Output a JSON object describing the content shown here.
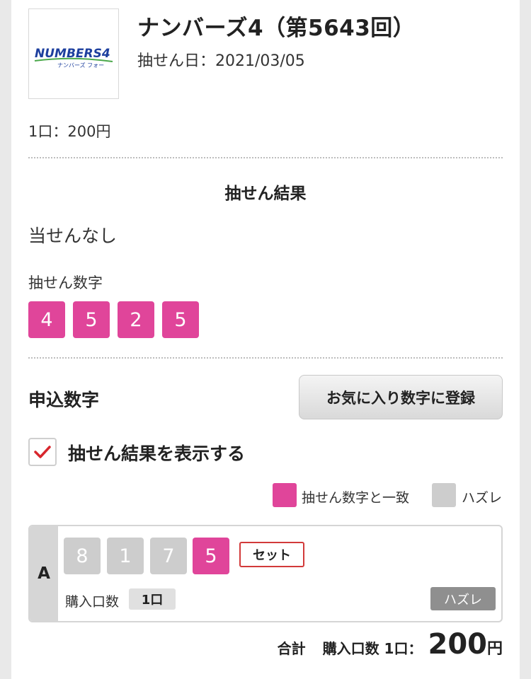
{
  "header": {
    "logo_text": "NUMBERS4",
    "logo_sub": "ナンバーズ フォー",
    "title": "ナンバーズ4（第5643回）",
    "draw_date": "抽せん日：2021/03/05",
    "unit_price": "1口：200円"
  },
  "result": {
    "heading": "抽せん結果",
    "status": "当せんなし",
    "numbers_label": "抽せん数字",
    "numbers": [
      "4",
      "5",
      "2",
      "5"
    ]
  },
  "application": {
    "label": "申込数字",
    "favorite_button": "お気に入り数字に登録",
    "show_result_label": "抽せん結果を表示する",
    "show_result_checked": true,
    "legend": {
      "match_label": "抽せん数字と一致",
      "miss_label": "ハズレ"
    },
    "entries": [
      {
        "letter": "A",
        "digits": [
          {
            "value": "8",
            "match": false
          },
          {
            "value": "1",
            "match": false
          },
          {
            "value": "7",
            "match": false
          },
          {
            "value": "5",
            "match": true
          }
        ],
        "type_badge": "セット",
        "qty_label": "購入口数",
        "qty_value": "1口",
        "result_badge": "ハズレ"
      }
    ]
  },
  "total": {
    "label": "合計",
    "qty_text": "購入口数 1口：",
    "amount": "200",
    "currency": "円"
  },
  "colors": {
    "match": "#e0459a",
    "miss": "#cdcdcd",
    "accent_red": "#d23a3a"
  }
}
